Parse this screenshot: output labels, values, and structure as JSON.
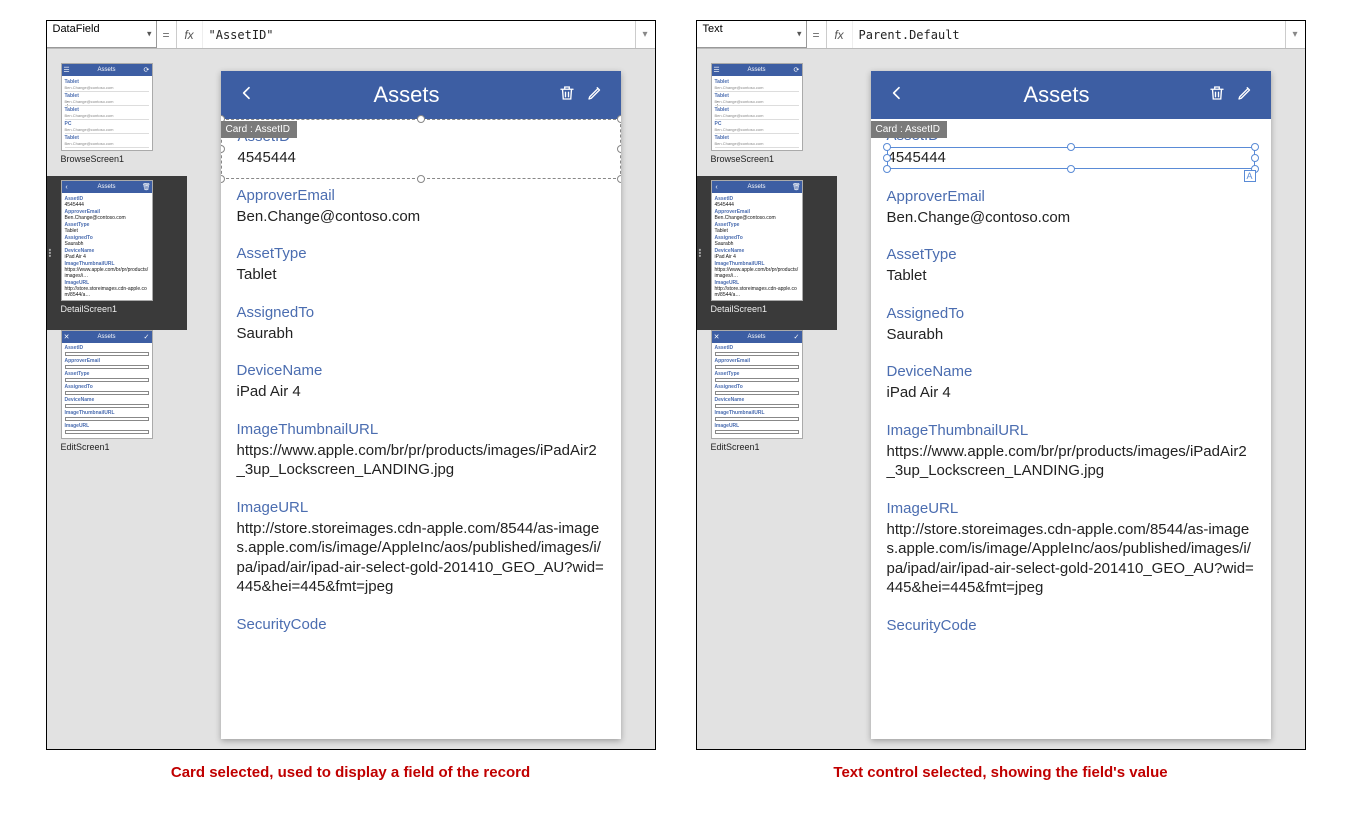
{
  "panels": [
    {
      "property_name": "DataField",
      "formula": "\"AssetID\"",
      "parent_property": "Parent.Default",
      "card_tag": "Card : AssetID",
      "caption": "Card selected, used to display a field of the record",
      "selection_type": "card"
    },
    {
      "property_name": "Text",
      "formula": "Parent.Default",
      "card_tag": "Card : AssetID",
      "caption": "Text control selected, showing the field's value",
      "selection_type": "text"
    }
  ],
  "device_header": {
    "title": "Assets"
  },
  "record": {
    "fields": [
      {
        "label": "AssetID",
        "value": "4545444"
      },
      {
        "label": "ApproverEmail",
        "value": "Ben.Change@contoso.com"
      },
      {
        "label": "AssetType",
        "value": "Tablet"
      },
      {
        "label": "AssignedTo",
        "value": "Saurabh"
      },
      {
        "label": "DeviceName",
        "value": "iPad Air 4"
      },
      {
        "label": "ImageThumbnailURL",
        "value": "https://www.apple.com/br/pr/products/images/iPadAir2_3up_Lockscreen_LANDING.jpg"
      },
      {
        "label": "ImageURL",
        "value": "http://store.storeimages.cdn-apple.com/8544/as-images.apple.com/is/image/AppleInc/aos/published/images/i/pa/ipad/air/ipad-air-select-gold-201410_GEO_AU?wid=445&hei=445&fmt=jpeg"
      },
      {
        "label": "SecurityCode",
        "value": ""
      }
    ]
  },
  "thumbnails": {
    "browse": {
      "label": "BrowseScreen1",
      "header": "Assets",
      "rows": [
        "Tablet",
        "Tablet",
        "Tablet",
        "PC",
        "Tablet"
      ]
    },
    "detail": {
      "label": "DetailScreen1",
      "header": "Assets"
    },
    "edit": {
      "label": "EditScreen1",
      "header": "Assets"
    }
  }
}
